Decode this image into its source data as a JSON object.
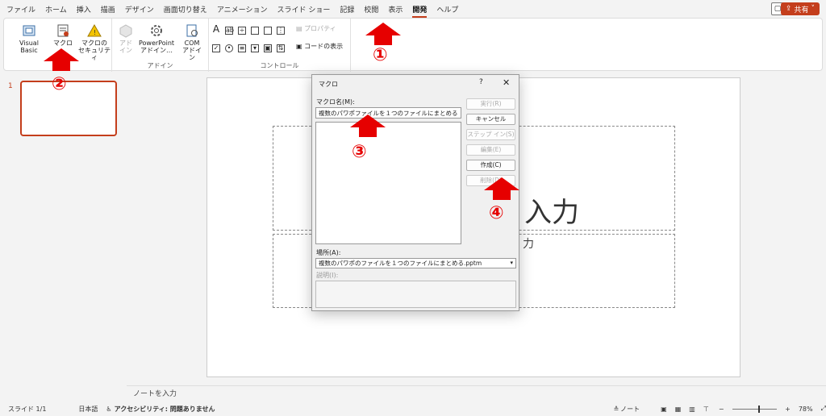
{
  "menu": {
    "tabs": [
      "ファイル",
      "ホーム",
      "挿入",
      "描画",
      "デザイン",
      "画面切り替え",
      "アニメーション",
      "スライド ショー",
      "記録",
      "校閲",
      "表示",
      "開発",
      "ヘルプ"
    ],
    "share_label": "共有",
    "comment_icon": "comment-icon"
  },
  "ribbon": {
    "code_group": {
      "vb": "Visual Basic",
      "macro": "マクロ",
      "security_l1": "マクロの",
      "security_l2": "セキュリティ"
    },
    "addin_group": {
      "addin_l1": "アド",
      "addin_l2": "イン",
      "pp_l1": "PowerPoint",
      "pp_l2": "アドイン…",
      "com_l1": "COM",
      "com_l2": "アドイン",
      "label": "アドイン"
    },
    "control_group": {
      "properties": "プロパティ",
      "view_code": "コードの表示",
      "label": "コントロール"
    }
  },
  "thumb": {
    "number": "1"
  },
  "slide": {
    "title": "入力",
    "subtitle": "力"
  },
  "notes": {
    "placeholder": "ノートを入力"
  },
  "status": {
    "slide": "スライド 1/1",
    "lang": "日本語",
    "accessibility": "アクセシビリティ: 問題ありません",
    "notes": "ノート",
    "zoom": "78%"
  },
  "dialog": {
    "title": "マクロ",
    "help": "?",
    "close": "✕",
    "macro_name_label": "マクロ名(M):",
    "macro_name_value": "複数のパワポファイルを１つのファイルにまとめる",
    "buttons": {
      "run": "実行(R)",
      "cancel": "キャンセル",
      "step": "ステップ イン(S)",
      "edit": "編集(E)",
      "create": "作成(C)",
      "delete": "削除(D)"
    },
    "location_label": "場所(A):",
    "location_value": "複数のパワポのファイルを１つのファイルにまとめる.pptm",
    "description_label": "説明(I):"
  },
  "annotations": {
    "n1": "①",
    "n2": "②",
    "n3": "③",
    "n4": "④"
  },
  "colors": {
    "accent": "#c43e1c",
    "annotation": "#e60000"
  }
}
